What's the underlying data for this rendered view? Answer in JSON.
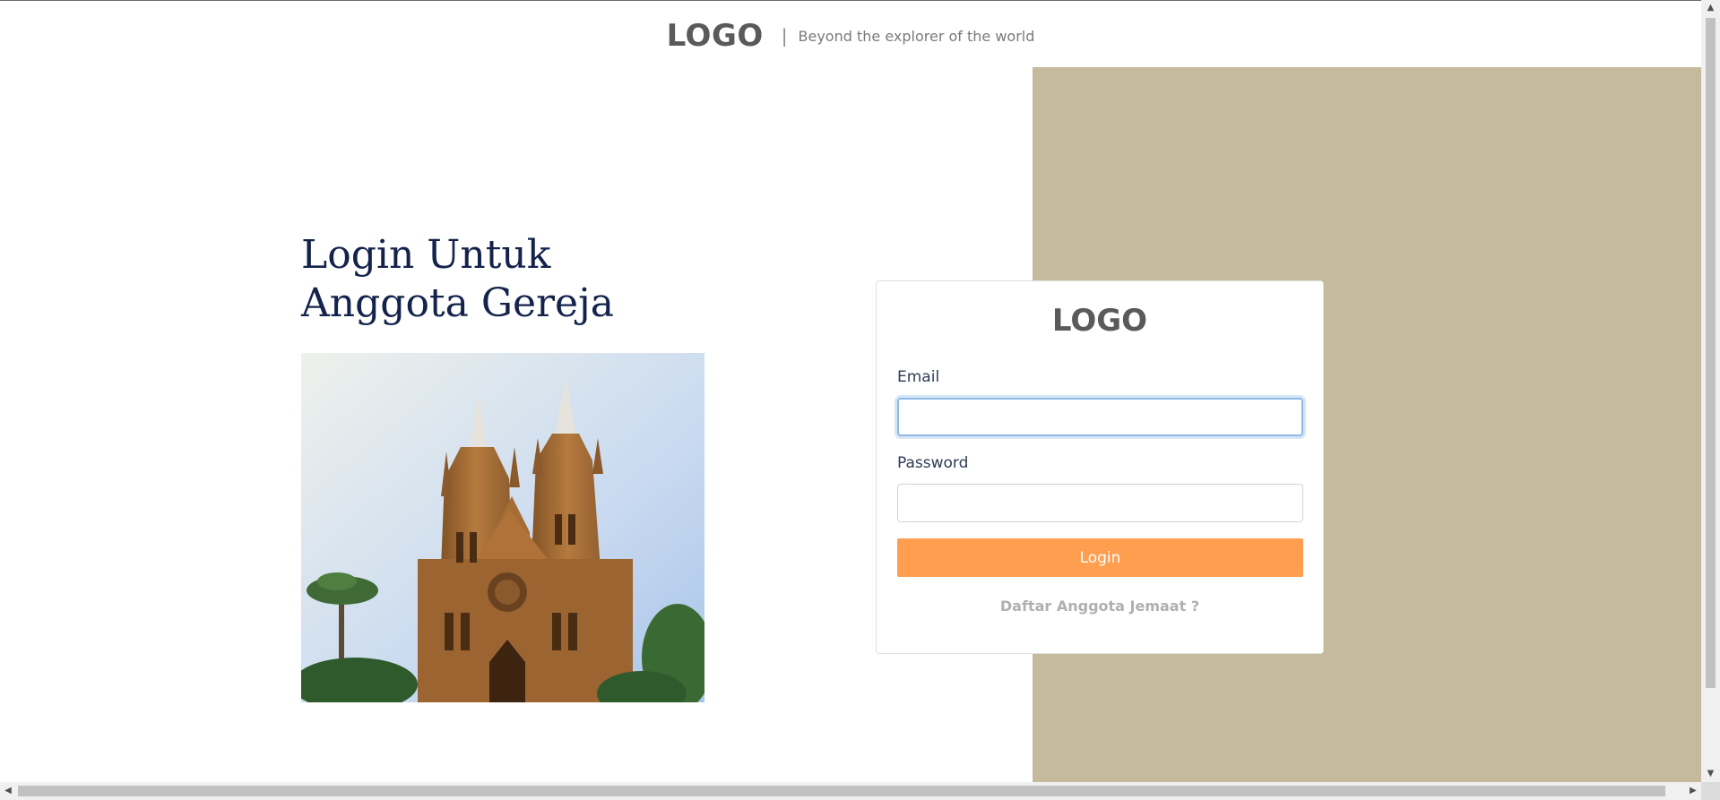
{
  "header": {
    "logo": "LOGO",
    "separator": "|",
    "tagline": "Beyond the explorer of the world"
  },
  "main": {
    "title": "Login Untuk Anggota Gereja",
    "image_icon": "cathedral-photo"
  },
  "login_card": {
    "logo": "LOGO",
    "email_label": "Email",
    "email_value": "",
    "password_label": "Password",
    "password_value": "",
    "login_button": "Login",
    "register_link": "Daftar Anggota Jemaat ?"
  },
  "scrollbars": {
    "up_arrow": "▲",
    "down_arrow": "▼",
    "left_arrow": "◀",
    "right_arrow": "▶"
  },
  "colors": {
    "accent": "#ff9e4f",
    "panel": "#c6ba9c",
    "title": "#14234c"
  }
}
